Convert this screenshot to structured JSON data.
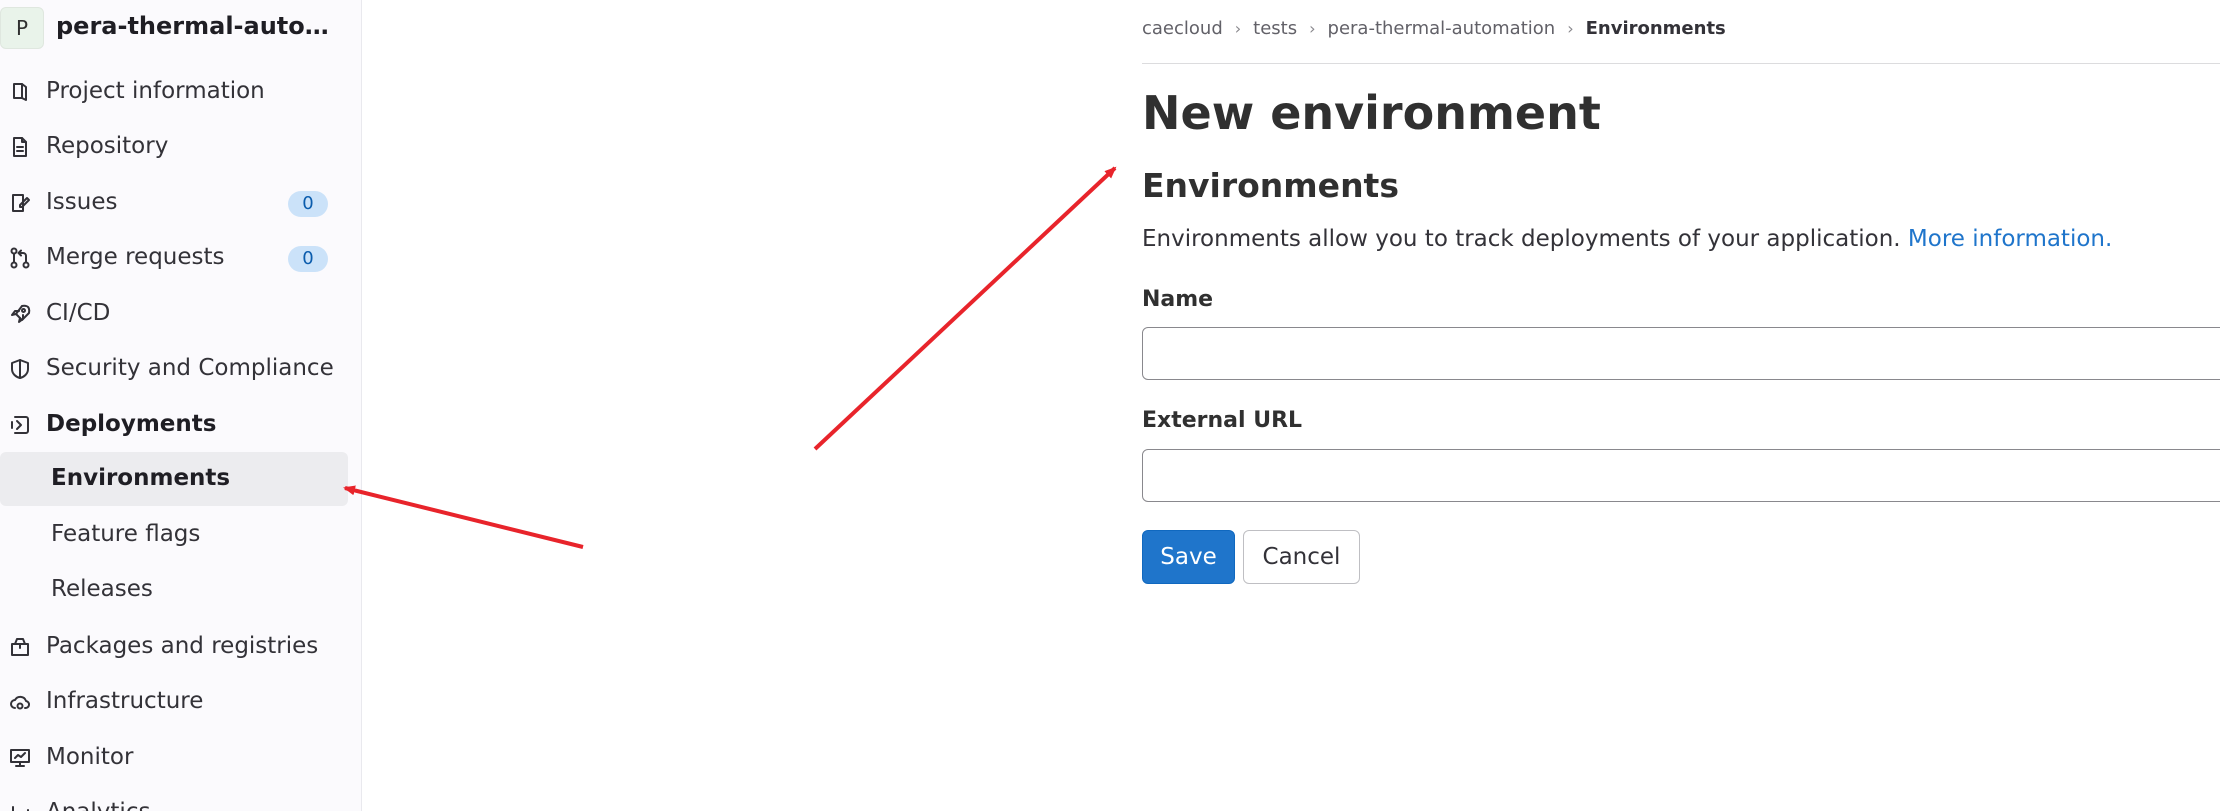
{
  "project": {
    "avatar_letter": "P",
    "name": "pera-thermal-automati..."
  },
  "sidebar": {
    "items": [
      {
        "label": "Project information",
        "icon": "project-info-icon"
      },
      {
        "label": "Repository",
        "icon": "document-icon"
      },
      {
        "label": "Issues",
        "icon": "issues-icon",
        "badge": "0"
      },
      {
        "label": "Merge requests",
        "icon": "merge-request-icon",
        "badge": "0"
      },
      {
        "label": "CI/CD",
        "icon": "rocket-icon"
      },
      {
        "label": "Security and Compliance",
        "icon": "shield-icon"
      },
      {
        "label": "Deployments",
        "icon": "deployments-icon"
      },
      {
        "label": "Packages and registries",
        "icon": "package-icon"
      },
      {
        "label": "Infrastructure",
        "icon": "cloud-gear-icon"
      },
      {
        "label": "Monitor",
        "icon": "monitor-icon"
      },
      {
        "label": "Analytics",
        "icon": "chart-icon"
      }
    ],
    "deployments_children": [
      {
        "label": "Environments"
      },
      {
        "label": "Feature flags"
      },
      {
        "label": "Releases"
      }
    ]
  },
  "breadcrumb": [
    "caecloud",
    "tests",
    "pera-thermal-automation",
    "Environments"
  ],
  "page": {
    "title": "New environment",
    "section_title": "Environments",
    "description": "Environments allow you to track deployments of your application.",
    "more_info_link": "More information."
  },
  "form": {
    "name_label": "Name",
    "name_value": "",
    "url_label": "External URL",
    "url_value": "",
    "save_label": "Save",
    "cancel_label": "Cancel"
  },
  "colors": {
    "accent": "#1f75cb",
    "badge_bg": "#cbe2f9",
    "annotation_arrow": "#e8242b"
  }
}
